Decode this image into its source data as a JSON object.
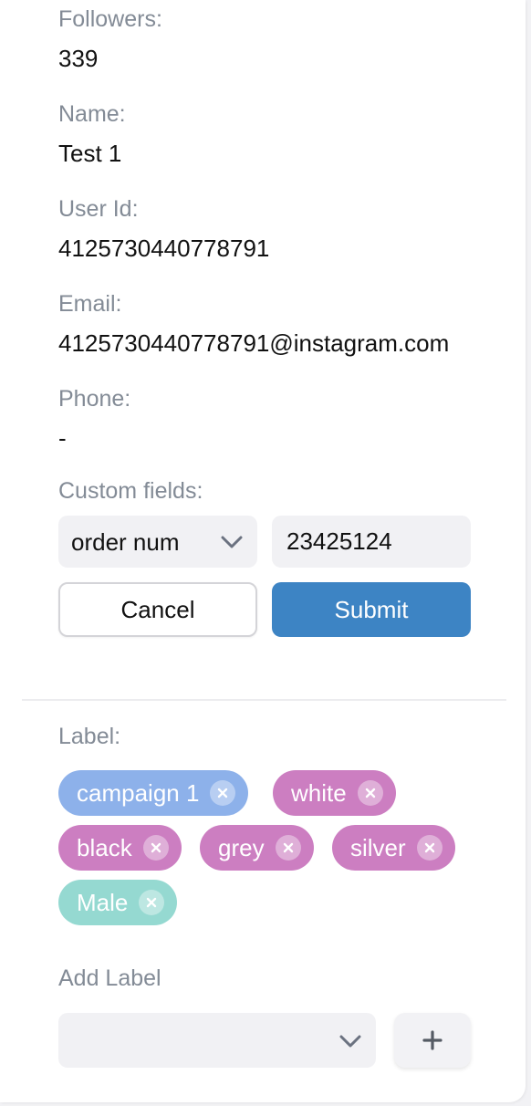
{
  "profile": {
    "followers_label": "Followers:",
    "followers_value": "339",
    "name_label": "Name:",
    "name_value": "Test 1",
    "user_id_label": "User Id:",
    "user_id_value": "4125730440778791",
    "email_label": "Email:",
    "email_value": "4125730440778791@instagram.com",
    "phone_label": "Phone:",
    "phone_value": "-"
  },
  "custom_fields": {
    "label": "Custom fields:",
    "field_select_value": "order num",
    "field_input_value": "23425124",
    "cancel_label": "Cancel",
    "submit_label": "Submit"
  },
  "labels": {
    "heading": "Label:",
    "tags": [
      {
        "text": "campaign 1",
        "color": "#8db1ea"
      },
      {
        "text": "white",
        "color": "#cc7ec1"
      },
      {
        "text": "black",
        "color": "#cc7ec1"
      },
      {
        "text": "grey",
        "color": "#cc7ec1"
      },
      {
        "text": "silver",
        "color": "#cc7ec1"
      },
      {
        "text": "Male",
        "color": "#95d9d1"
      }
    ],
    "remove_icon": "close-icon"
  },
  "add_label": {
    "heading": "Add Label",
    "select_value": "",
    "add_icon": "plus-icon"
  }
}
